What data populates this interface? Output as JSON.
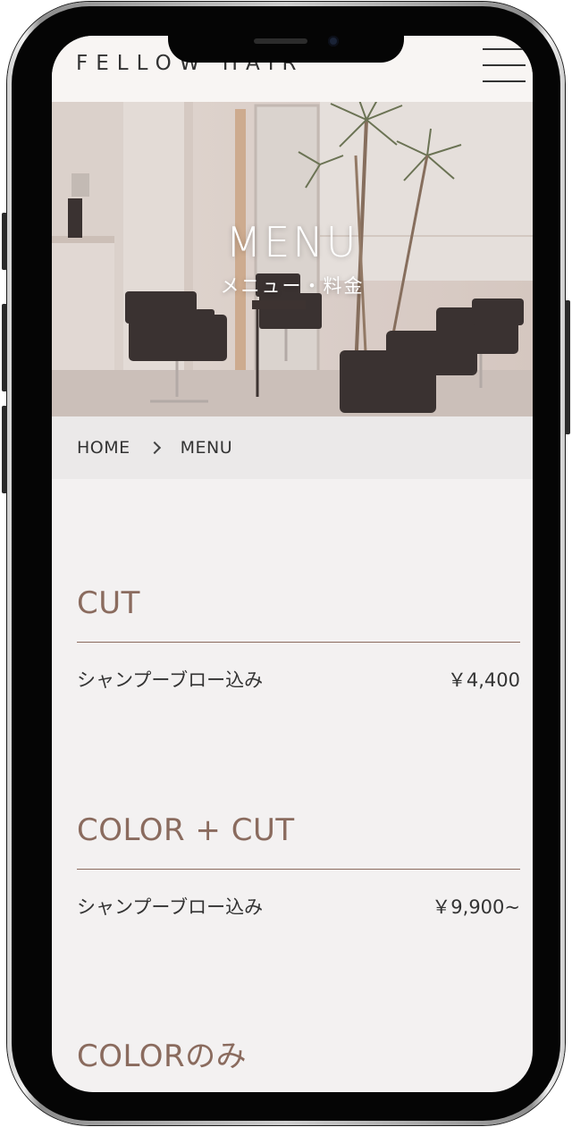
{
  "header": {
    "logo": "FELLOW HAIR",
    "menu_icon": "hamburger-menu-icon"
  },
  "hero": {
    "title": "MENU",
    "subtitle": "メニュー・料金"
  },
  "breadcrumb": {
    "home": "HOME",
    "current": "MENU",
    "separator_icon": "chevron-right-icon"
  },
  "menu": {
    "sections": [
      {
        "title": "CUT",
        "items": [
          {
            "name": "シャンプーブロー込み",
            "price": "￥4,400"
          }
        ]
      },
      {
        "title": "COLOR + CUT",
        "items": [
          {
            "name": "シャンプーブロー込み",
            "price": "￥9,900~"
          }
        ]
      },
      {
        "title": "COLORのみ",
        "items": []
      }
    ]
  },
  "colors": {
    "accent": "#8a6b5e",
    "text": "#333333",
    "background": "#f3f1f1",
    "breadcrumb_bg": "#ebe9e9"
  }
}
